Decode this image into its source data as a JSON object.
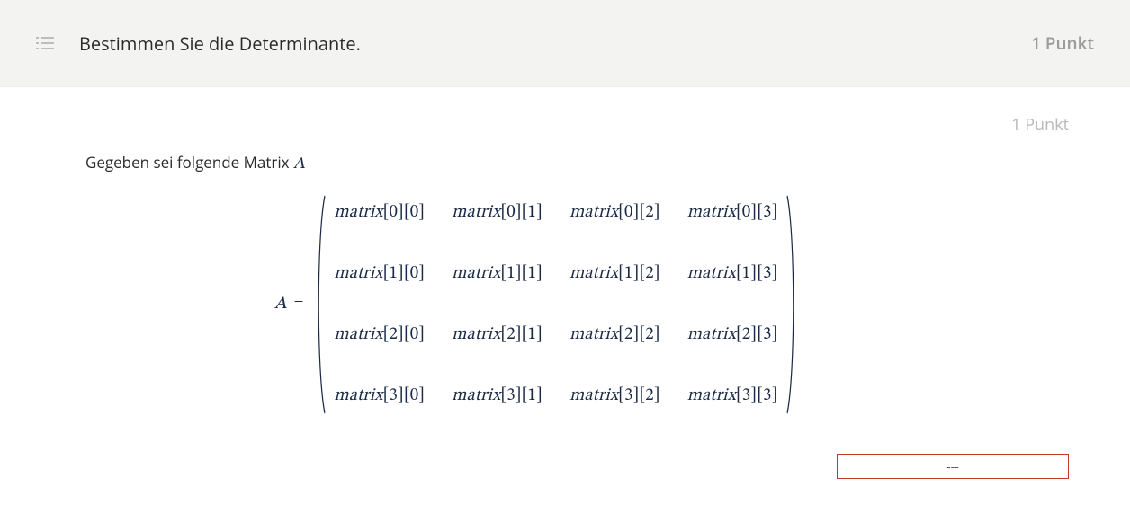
{
  "header": {
    "title": "Bestimmen Sie die Determinante.",
    "points": "1 Punkt"
  },
  "content": {
    "sub_points": "1 Punkt",
    "intro_prefix": "Gegeben sei folgende Matrix ",
    "intro_var": "A",
    "eq_var": "A",
    "eq_sign": "=",
    "matrix": {
      "rows": 4,
      "cols": 4,
      "name": "matrix",
      "cells": [
        [
          "matrix[0][0]",
          "matrix[0][1]",
          "matrix[0][2]",
          "matrix[0][3]"
        ],
        [
          "matrix[1][0]",
          "matrix[1][1]",
          "matrix[1][2]",
          "matrix[1][3]"
        ],
        [
          "matrix[2][0]",
          "matrix[2][1]",
          "matrix[2][2]",
          "matrix[2][3]"
        ],
        [
          "matrix[3][0]",
          "matrix[3][1]",
          "matrix[3][2]",
          "matrix[3][3]"
        ]
      ]
    },
    "answer_value": "---"
  }
}
